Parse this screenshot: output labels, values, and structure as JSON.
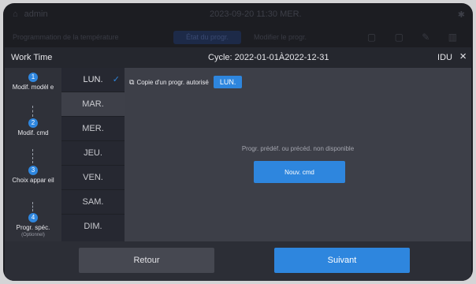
{
  "background": {
    "status_user": "admin",
    "status_time": "2023-09-20 11:30 MER.",
    "toolbar_text": "Programmation de la température",
    "tab_active": "État du progr.",
    "tab_other": "Modifier le progr."
  },
  "modal": {
    "title": "Work Time",
    "cycle": "Cycle:  2022-01-01À2022-12-31",
    "idu": "IDU",
    "close_icon": "×"
  },
  "steps": [
    {
      "num": "1",
      "label": "Modif. modèl e",
      "sub": ""
    },
    {
      "num": "2",
      "label": "Modif. cmd",
      "sub": ""
    },
    {
      "num": "3",
      "label": "Choix appar eil",
      "sub": ""
    },
    {
      "num": "4",
      "label": "Progr. spéc.",
      "sub": "(Optionnel)"
    }
  ],
  "days": [
    "LUN.",
    "MAR.",
    "MER.",
    "JEU.",
    "VEN.",
    "SAM.",
    "DIM."
  ],
  "active_day": "LUN.",
  "selected_day": "MAR.",
  "copy": {
    "label": "Copie d'un progr. autorisé",
    "day": "LUN."
  },
  "content": {
    "no_data": "Progr. prédéf. ou précéd. non disponible",
    "new_button": "Nouv. cmd"
  },
  "footer": {
    "back": "Retour",
    "next": "Suivant"
  },
  "colors": {
    "accent": "#2e86de",
    "modal_bg": "#2c2e36",
    "content_bg": "#3d3f48"
  }
}
